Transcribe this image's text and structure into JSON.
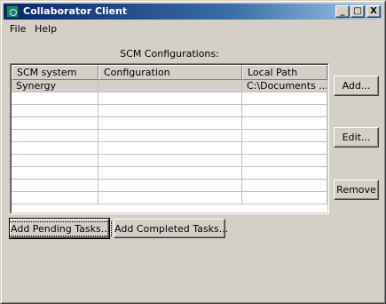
{
  "window": {
    "title": "Collaborator Client"
  },
  "title_buttons": {
    "minimize": "_",
    "maximize": "□",
    "close": "X"
  },
  "menu": {
    "file": "File",
    "help": "Help"
  },
  "section_label": "SCM Configurations:",
  "table": {
    "columns": [
      "SCM system",
      "Configuration",
      "Local Path"
    ],
    "rows": [
      {
        "scm": "Synergy",
        "config": "",
        "path": "C:\\Documents ..."
      }
    ]
  },
  "buttons": {
    "add": "Add...",
    "edit": "Edit...",
    "remove": "Remove",
    "add_pending": "Add Pending Tasks...",
    "add_completed": "Add Completed Tasks..."
  }
}
